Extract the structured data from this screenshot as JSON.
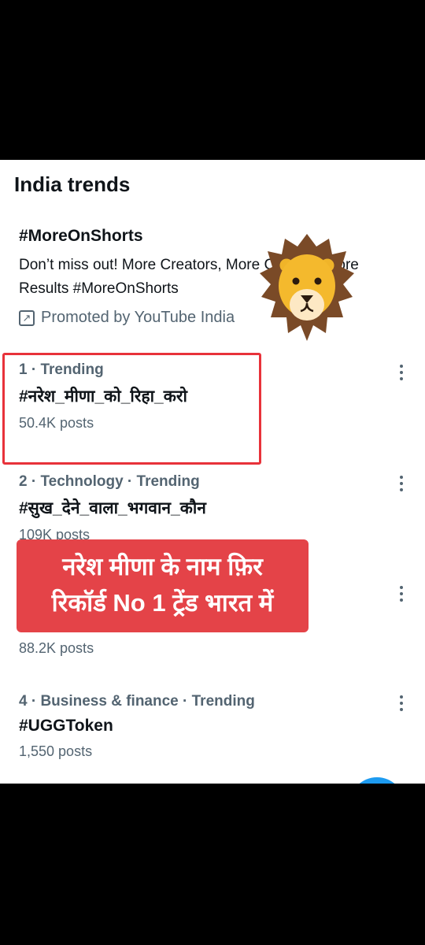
{
  "header": {
    "title": "India trends"
  },
  "promo": {
    "tag": "#MoreOnShorts",
    "description": "Don’t miss out! More Creators, More Content, More Results #MoreOnShorts",
    "promoted_label": "Promoted by YouTube India",
    "icon": "arrow-up-right-icon"
  },
  "trends": [
    {
      "meta": "1 · Trending",
      "name": "#नरेश_मीणा_को_रिहा_करो",
      "posts": "50.4K posts"
    },
    {
      "meta": "2 · Technology · Trending",
      "name": "#सुख_देने_वाला_भगवान_कौन",
      "posts": "109K posts"
    },
    {
      "meta": "",
      "name": "",
      "posts": "88.2K posts"
    },
    {
      "meta": "4 · Business & finance · Trending",
      "name": "#UGGToken",
      "posts": "1,550 posts"
    }
  ],
  "overlay": {
    "banner_line1": "नरेश मीणा के नाम फ़िर",
    "banner_line2": "रिकॉर्ड No 1 ट्रेंड भारत में",
    "banner_color": "#e44348",
    "highlight_color": "#e8323a",
    "sticker": "lion-face-icon"
  },
  "colors": {
    "accent": "#1d9bf0",
    "secondary_text": "#536471"
  }
}
